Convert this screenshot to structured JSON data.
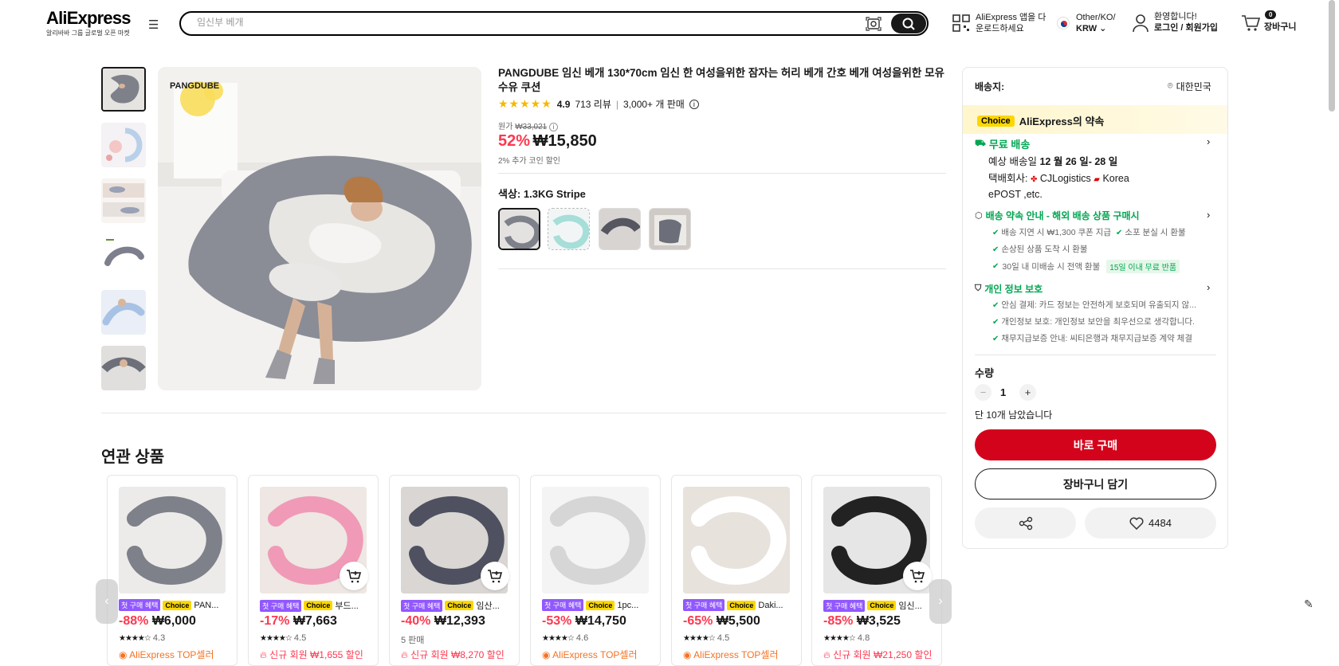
{
  "header": {
    "logo": "AliExpress",
    "logo_sub": "알리바바 그룹 글로벌 오픈 마켓",
    "search_placeholder": "임신부 베개",
    "app_line1": "AliExpress 앱을 다",
    "app_line2": "운로드하세요",
    "locale_line1": "Other/KO/",
    "locale_line2": "KRW",
    "welcome": "환영합니다!",
    "login": "로그인 / 회원가입",
    "cart_label": "장바구니",
    "cart_count": "0"
  },
  "gallery": {
    "main_brand": "PANGDUBE",
    "thumbnail_count": 6
  },
  "product": {
    "title": "PANGDUBE 임신 베개 130*70cm 임신 한 여성을위한 잠자는 허리 베개 간호 베개 여성을위한 모유 수유 쿠션",
    "rating": "4.9",
    "reviews": "713 리뷰",
    "sold": "3,000+ 개 판매",
    "orig_label": "원가",
    "orig_price": "₩33,021",
    "discount": "52%",
    "price": "₩15,850",
    "coin": "2% 추가 코인 할인",
    "color_label": "색상:",
    "color_value": "1.3KG Stripe"
  },
  "panel": {
    "ship_to_label": "배송지:",
    "ship_to_value": "대한민국",
    "choice_tag": "Choice",
    "promise": "AliExpress의 약속",
    "free_ship": "무료 배송",
    "eta_prefix": "예상 배송일",
    "eta": "12 월 26 일- 28 일",
    "carrier_prefix": "택배회사:",
    "carrier_1": "CJLogistics",
    "carrier_2": "Korea",
    "carrier_3": "ePOST ,etc.",
    "guarantee_title": "배송 약속 안내 - 해외 배송 상품 구매시",
    "g1": "배송 지연 시 ₩1,300 쿠폰 지급",
    "g2": "소포 분실 시 환불",
    "g3": "손상된 상품 도착 시 환불",
    "g4": "30일 내 미배송 시 전액 환불",
    "g4_badge": "15일 이내 무료 반품",
    "privacy_title": "개인 정보 보호",
    "p1": "안심 결제: 카드 정보는 안전하게 보호되며 유출되지 않...",
    "p2": "개인정보 보호: 개인정보 보안을 최우선으로 생각합니다.",
    "p3": "채무지급보증 안내: 씨티은행과 채무지급보증 계약 체결",
    "qty_label": "수량",
    "qty_value": "1",
    "stock": "단 10개 남았습니다",
    "buy_now": "바로 구매",
    "add_cart": "장바구니 담기",
    "wishlist_count": "4484"
  },
  "related": {
    "title": "연관 상품",
    "first_badge": "첫 구매 혜택",
    "choice_badge": "Choice",
    "items": [
      {
        "name": "PAN...",
        "discount": "-88%",
        "price": "₩6,000",
        "stars": "★★★★☆",
        "rating": "4.3",
        "sold": "",
        "promo": "AliExpress TOP셀러",
        "promo_type": "org",
        "has_cart": false
      },
      {
        "name": "부드...",
        "discount": "-17%",
        "price": "₩7,663",
        "stars": "★★★★☆",
        "rating": "4.5",
        "sold": "",
        "promo": "신규 회원 ₩1,655 할인",
        "promo_type": "red",
        "has_cart": true
      },
      {
        "name": "임산...",
        "discount": "-40%",
        "price": "₩12,393",
        "stars": "",
        "rating": "",
        "sold": "5 판매",
        "promo": "신규 회원 ₩8,270 할인",
        "promo_type": "red",
        "has_cart": true
      },
      {
        "name": "1pc...",
        "discount": "-53%",
        "price": "₩14,750",
        "stars": "★★★★☆",
        "rating": "4.6",
        "sold": "",
        "promo": "AliExpress TOP셀러",
        "promo_type": "org",
        "has_cart": false
      },
      {
        "name": "Daki...",
        "discount": "-65%",
        "price": "₩5,500",
        "stars": "★★★★☆",
        "rating": "4.5",
        "sold": "",
        "promo": "AliExpress TOP셀러",
        "promo_type": "org",
        "has_cart": false
      },
      {
        "name": "임신...",
        "discount": "-85%",
        "price": "₩3,525",
        "stars": "★★★★☆",
        "rating": "4.8",
        "sold": "",
        "promo": "신규 회원 ₩21,250 할인",
        "promo_type": "red",
        "has_cart": true
      }
    ]
  }
}
